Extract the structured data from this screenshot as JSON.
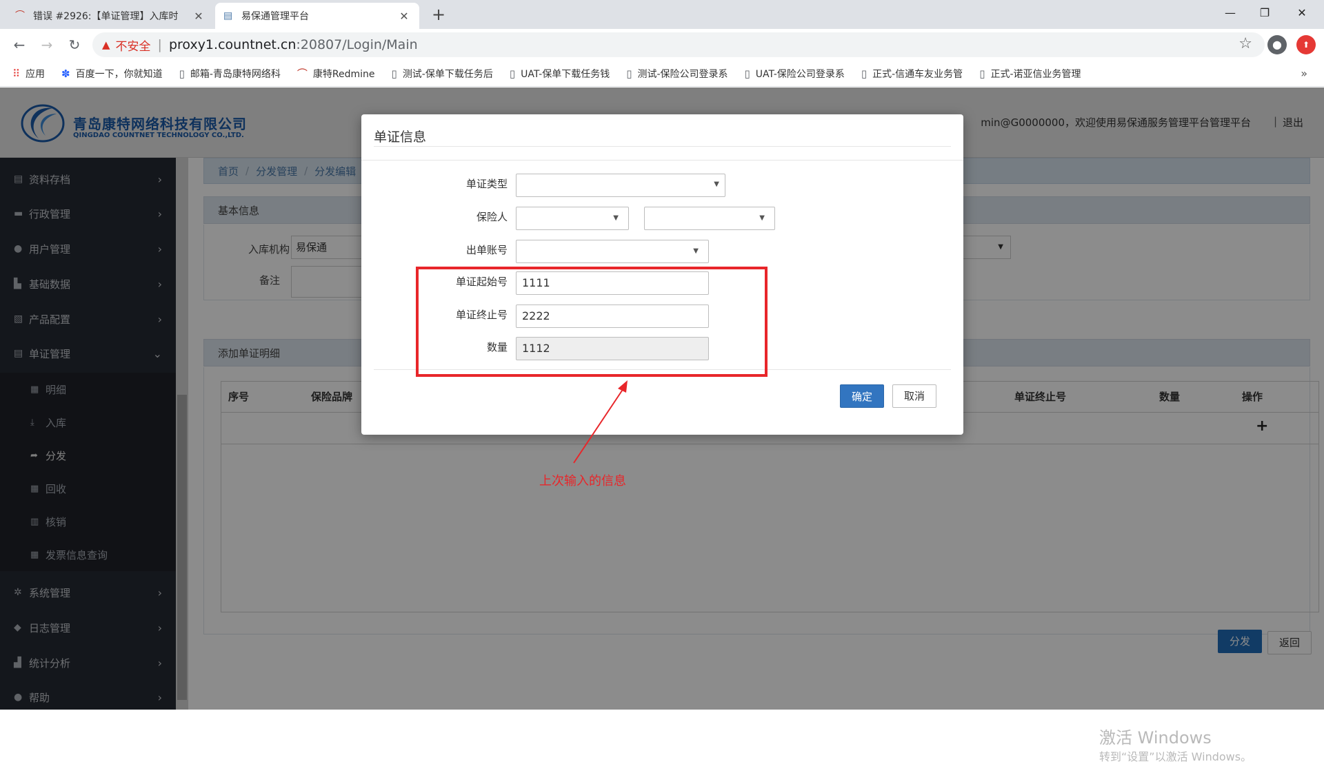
{
  "browser": {
    "tabs": [
      {
        "title": "错误 #2926:【单证管理】入库时",
        "active": false
      },
      {
        "title": "易保通管理平台",
        "active": true
      }
    ],
    "new_tab": "+",
    "window_controls": {
      "minimize": "—",
      "maximize": "❐",
      "close": "✕"
    },
    "address": {
      "security_label": "不安全",
      "url_host": "proxy1.countnet.cn",
      "url_rest": ":20807/Login/Main"
    },
    "bookmarks": [
      {
        "label": "应用",
        "icon": "apps-grid-icon"
      },
      {
        "label": "百度一下，你就知道",
        "icon": "baidu-paw-icon"
      },
      {
        "label": "邮箱-青岛康特网络科",
        "icon": "page-icon"
      },
      {
        "label": "康特Redmine",
        "icon": "redmine-icon"
      },
      {
        "label": "测试-保单下载任务后",
        "icon": "page-icon"
      },
      {
        "label": "UAT-保单下载任务钱",
        "icon": "page-icon"
      },
      {
        "label": "测试-保险公司登录系",
        "icon": "page-icon"
      },
      {
        "label": "UAT-保险公司登录系",
        "icon": "page-icon"
      },
      {
        "label": "正式-信通车友业务管",
        "icon": "page-icon"
      },
      {
        "label": "正式-诺亚信业务管理",
        "icon": "page-icon"
      }
    ],
    "bookmarks_more": "»"
  },
  "header": {
    "company_cn": "青岛康特网络科技有限公司",
    "company_en": "QINGDAO COUNTNET TECHNOLOGY CO.,LTD.",
    "welcome": "min@G0000000，欢迎使用易保通服务管理平台管理平台",
    "separator": "|",
    "logout": "退出"
  },
  "sidebar": {
    "items": [
      {
        "label": "资料存档",
        "icon": "archive-icon"
      },
      {
        "label": "行政管理",
        "icon": "briefcase-icon"
      },
      {
        "label": "用户管理",
        "icon": "user-icon"
      },
      {
        "label": "基础数据",
        "icon": "database-icon"
      },
      {
        "label": "产品配置",
        "icon": "product-icon"
      },
      {
        "label": "单证管理",
        "icon": "document-icon",
        "expanded": true
      }
    ],
    "sub_items": [
      {
        "label": "明细",
        "icon": "grid-icon"
      },
      {
        "label": "入库",
        "icon": "import-icon"
      },
      {
        "label": "分发",
        "icon": "share-icon",
        "active": true
      },
      {
        "label": "回收",
        "icon": "grid-icon"
      },
      {
        "label": "核销",
        "icon": "trash-icon"
      },
      {
        "label": "发票信息查询",
        "icon": "grid-icon"
      }
    ],
    "bottom_items": [
      {
        "label": "系统管理",
        "icon": "gear-icon"
      },
      {
        "label": "日志管理",
        "icon": "tag-icon"
      },
      {
        "label": "统计分析",
        "icon": "bar-chart-icon"
      },
      {
        "label": "帮助",
        "icon": "info-icon"
      }
    ]
  },
  "breadcrumb": [
    "首页",
    "分发管理",
    "分发编辑"
  ],
  "basic_info": {
    "title": "基本信息",
    "org_label": "入库机构",
    "org_value": "易保通",
    "remark_label": "备注"
  },
  "detail": {
    "title": "添加单证明细",
    "columns": [
      "序号",
      "保险品牌",
      "单证终止号",
      "数量",
      "操作"
    ],
    "add_icon": "+"
  },
  "actions": {
    "distribute": "分发",
    "back": "返回"
  },
  "watermark": {
    "line1": "激活 Windows",
    "line2": "转到“设置”以激活 Windows。"
  },
  "modal": {
    "title": "单证信息",
    "fields": {
      "doc_type_label": "单证类型",
      "insurer_label": "保险人",
      "account_label": "出单账号",
      "start_label": "单证起始号",
      "start_value": "1111",
      "end_label": "单证终止号",
      "end_value": "2222",
      "qty_label": "数量",
      "qty_value": "1112"
    },
    "ok": "确定",
    "cancel": "取消"
  },
  "annotation": {
    "text": "上次输入的信息",
    "color": "#e8262a"
  }
}
